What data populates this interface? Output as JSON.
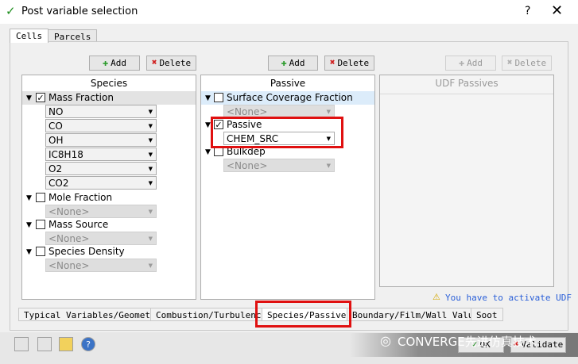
{
  "window": {
    "title": "Post variable selection",
    "help": "?",
    "close": "✕"
  },
  "top_tabs": [
    {
      "label": "Cells"
    },
    {
      "label": "Parcels"
    }
  ],
  "buttons": {
    "add": "Add",
    "delete": "Delete"
  },
  "species_panel": {
    "title": "Species",
    "groups": [
      {
        "label": "Mass Fraction",
        "checked": true,
        "items": [
          "NO",
          "CO",
          "OH",
          "IC8H18",
          "O2",
          "CO2"
        ]
      },
      {
        "label": "Mole Fraction",
        "checked": false,
        "items": [
          "<None>"
        ]
      },
      {
        "label": "Mass Source",
        "checked": false,
        "items": [
          "<None>"
        ]
      },
      {
        "label": "Species Density",
        "checked": false,
        "items": [
          "<None>"
        ]
      }
    ]
  },
  "passive_panel": {
    "title": "Passive",
    "groups": [
      {
        "label": "Surface Coverage Fraction",
        "checked": false,
        "items": [
          "<None>"
        ]
      },
      {
        "label": "Passive",
        "checked": true,
        "items": [
          "CHEM_SRC"
        ]
      },
      {
        "label": "Bulkdep",
        "checked": false,
        "items": [
          "<None>"
        ]
      }
    ]
  },
  "udf_panel": {
    "title": "UDF Passives"
  },
  "udf_message": "You have to activate UDF",
  "bottom_tabs": [
    {
      "label": "Typical Variables/Geometry"
    },
    {
      "label": "Combustion/Turbulence"
    },
    {
      "label": "Species/Passive"
    },
    {
      "label": "Boundary/Film/Wall Value"
    },
    {
      "label": "Soot"
    }
  ],
  "footer": {
    "ok": "OK",
    "validate": "Validate",
    "watermark": "CONVERGE先进仿真技术"
  },
  "colors": {
    "highlight": "#e01010",
    "accent": "#2a5fd8",
    "check": "#1f8f1f"
  }
}
